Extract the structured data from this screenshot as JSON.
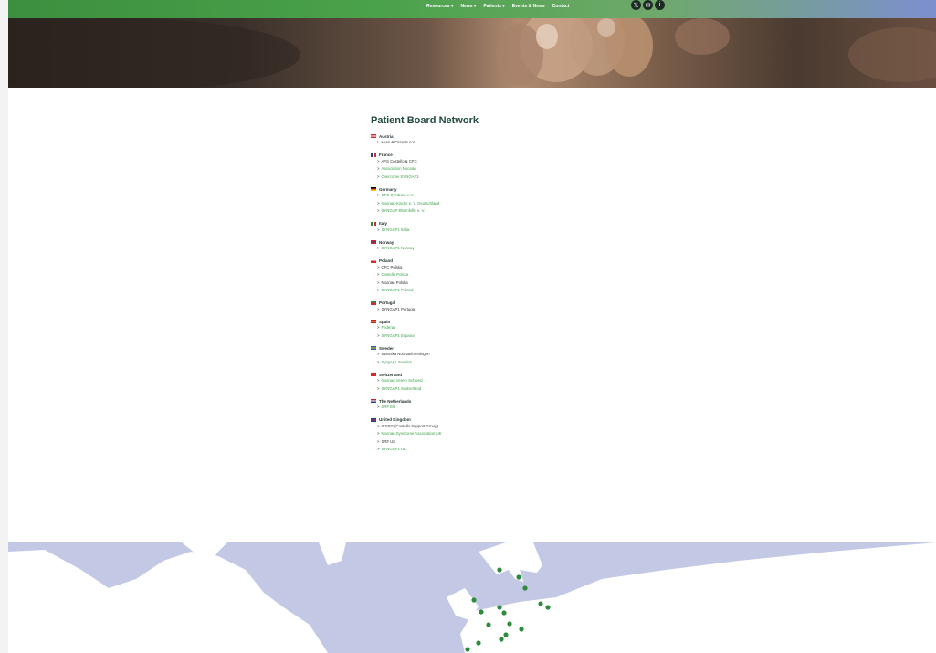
{
  "nav": {
    "items": [
      "Resources ▾",
      "News ▾",
      "Patients ▾",
      "Events & News",
      "Contact"
    ]
  },
  "social": {
    "icons": [
      "x-icon",
      "email-icon",
      "info-icon"
    ]
  },
  "main": {
    "title": "Patient Board Network",
    "countries": [
      {
        "name": "Austria",
        "flag": [
          "#d7282f",
          "#ffffff",
          "#d7282f"
        ],
        "orgs": [
          {
            "label": "Leon & Friends e.V.",
            "link": false
          }
        ]
      },
      {
        "name": "France",
        "flag": [
          "#233e99",
          "#ffffff",
          "#d7282f"
        ],
        "vertical": true,
        "orgs": [
          {
            "label": "AFS Costello & CFC",
            "link": false
          },
          {
            "label": "Association Noonan",
            "link": true
          },
          {
            "label": "Overcome SYNGAP1",
            "link": true
          }
        ]
      },
      {
        "name": "Germany",
        "flag": [
          "#000000",
          "#d7282f",
          "#f7c600"
        ],
        "orgs": [
          {
            "label": "CFC Syndrom e.V.",
            "link": true
          },
          {
            "label": "Noonan-Kinder e. V. Deutschland",
            "link": true
          },
          {
            "label": "SYNGAP Elternhilfe e. V.",
            "link": true
          }
        ]
      },
      {
        "name": "Italy",
        "flag": [
          "#2e8b3d",
          "#ffffff",
          "#d7282f"
        ],
        "vertical": true,
        "orgs": [
          {
            "label": "SYNGAP1 Italia",
            "link": true
          }
        ]
      },
      {
        "name": "Norway",
        "flag": [
          "#d7282f",
          "#233e99",
          "#d7282f"
        ],
        "orgs": [
          {
            "label": "SYNGAP1 Norway",
            "link": true
          }
        ]
      },
      {
        "name": "Poland",
        "flag": [
          "#ffffff",
          "#d7282f",
          "#d7282f"
        ],
        "orgs": [
          {
            "label": "CFC Polska",
            "link": false
          },
          {
            "label": "Costello Polska",
            "link": true
          },
          {
            "label": "Noonan Polska",
            "link": false
          },
          {
            "label": "SYNGAP1 Poland",
            "link": true
          }
        ]
      },
      {
        "name": "Portugal",
        "flag": [
          "#2e8b3d",
          "#d7282f",
          "#d7282f"
        ],
        "orgs": [
          {
            "label": "SYNGAP1 Portugal",
            "link": false
          }
        ]
      },
      {
        "name": "Spain",
        "flag": [
          "#c8202e",
          "#f7c600",
          "#c8202e"
        ],
        "orgs": [
          {
            "label": "Federas",
            "link": true
          },
          {
            "label": "SYNGAP1 Espana",
            "link": true
          }
        ]
      },
      {
        "name": "Sweden",
        "flag": [
          "#2a5fa8",
          "#f7c600",
          "#2a5fa8"
        ],
        "orgs": [
          {
            "label": "Svenska Noonanföreningen",
            "link": false
          },
          {
            "label": "Syngap1 Sweden",
            "link": true
          }
        ]
      },
      {
        "name": "Switzerland",
        "flag": [
          "#d7282f",
          "#d7282f",
          "#d7282f"
        ],
        "orgs": [
          {
            "label": "Noonan Verein Schweiz",
            "link": true
          },
          {
            "label": "SYNGAP1 Switzerland",
            "link": true
          }
        ]
      },
      {
        "name": "The Netherlands",
        "flag": [
          "#c8202e",
          "#ffffff",
          "#233e99"
        ],
        "orgs": [
          {
            "label": "SRF EU",
            "link": true
          }
        ]
      },
      {
        "name": "United Kingdom",
        "flag": [
          "#233e99",
          "#d7282f",
          "#233e99"
        ],
        "orgs": [
          {
            "label": "ICSSG (Costello Support Group)",
            "link": false
          },
          {
            "label": "Noonan Syndrome Association UK",
            "link": true
          },
          {
            "label": "SRF UK",
            "link": false
          },
          {
            "label": "SYNGAP1 UK",
            "link": true
          }
        ]
      }
    ]
  },
  "map": {
    "land_color": "#ffffff",
    "water_color": "#c3c9e4",
    "marker_color": "#2e8b3d"
  }
}
